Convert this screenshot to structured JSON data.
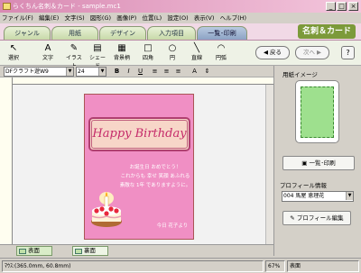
{
  "window": {
    "title": "らくちん名刺＆カード - sample.mc1",
    "min": "_",
    "max": "□",
    "close": "×"
  },
  "menu": [
    "ファイル(F)",
    "編集(E)",
    "文字(S)",
    "図形(G)",
    "画像(P)",
    "位置(L)",
    "設定(O)",
    "表示(V)",
    "ヘルプ(H)"
  ],
  "tabs": [
    "ジャンル",
    "用紙",
    "デザイン",
    "入力項目",
    "一覧･印刷"
  ],
  "logo": "名刺＆カード",
  "tools": [
    {
      "label": "選択",
      "icon": "cursor-icon",
      "glyph": "↖"
    },
    {
      "label": "文字",
      "icon": "text-icon",
      "glyph": "A"
    },
    {
      "label": "イラスト",
      "icon": "illustration-icon",
      "glyph": "✎"
    },
    {
      "label": "シェード",
      "icon": "shade-icon",
      "glyph": "▤"
    },
    {
      "label": "背景柄",
      "icon": "pattern-icon",
      "glyph": "▦"
    },
    {
      "label": "四角",
      "icon": "rectangle-icon",
      "glyph": "□"
    },
    {
      "label": "円",
      "icon": "circle-icon",
      "glyph": "○"
    },
    {
      "label": "直線",
      "icon": "line-icon",
      "glyph": "╲"
    },
    {
      "label": "円弧",
      "icon": "arc-icon",
      "glyph": "◠"
    }
  ],
  "nav": {
    "back": "◀ 戻る",
    "next": "次へ ▶",
    "help": "?"
  },
  "format": {
    "font": "DFクラフト遊W9",
    "size": "24",
    "bold": "B",
    "italic": "I",
    "underline": "U"
  },
  "card": {
    "title": "Happy Birthday",
    "message": [
      "お誕生日 おめでとう！",
      "これからも 幸せ 笑顔 あふれる",
      "素敵な 1年 でありますように。"
    ],
    "signature": "今日 花子より"
  },
  "page_tabs": [
    "表面",
    "裏面"
  ],
  "panel": {
    "image_label": "用紙イメージ",
    "print_button": "一覧･印刷",
    "profile_label": "プロフィール情報",
    "profile_value": "004  馬屋  恵理花",
    "profile_edit": "プロフィール編集"
  },
  "status": {
    "coords": "ﾏｳｽ:(365.0mm, 60.8mm)",
    "zoom": "67%",
    "side": "表面"
  }
}
